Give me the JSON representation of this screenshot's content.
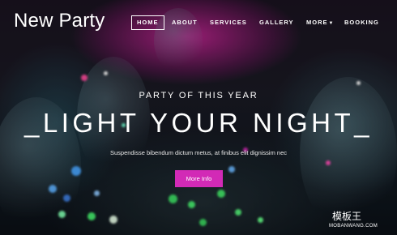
{
  "brand": {
    "title": "New Party"
  },
  "nav": {
    "items": [
      {
        "label": "HOME",
        "active": true
      },
      {
        "label": "ABOUT",
        "active": false
      },
      {
        "label": "SERVICES",
        "active": false
      },
      {
        "label": "GALLERY",
        "active": false
      },
      {
        "label": "MORE",
        "active": false,
        "has_dropdown": true
      },
      {
        "label": "BOOKING",
        "active": false
      }
    ]
  },
  "hero": {
    "kicker": "PARTY OF THIS YEAR",
    "headline": "_LIGHT YOUR NIGHT_",
    "tagline": "Suspendisse bibendum dictum metus, at finibus elit dignissim nec",
    "cta_label": "More Info"
  },
  "watermark": {
    "logo_text": "模板王",
    "subtitle": "MOBANWANG.COM"
  },
  "colors": {
    "accent": "#d22ab6",
    "stage_glow": "#d626a0",
    "text": "#ffffff"
  },
  "icons": {
    "dropdown": "caret-down-icon"
  }
}
